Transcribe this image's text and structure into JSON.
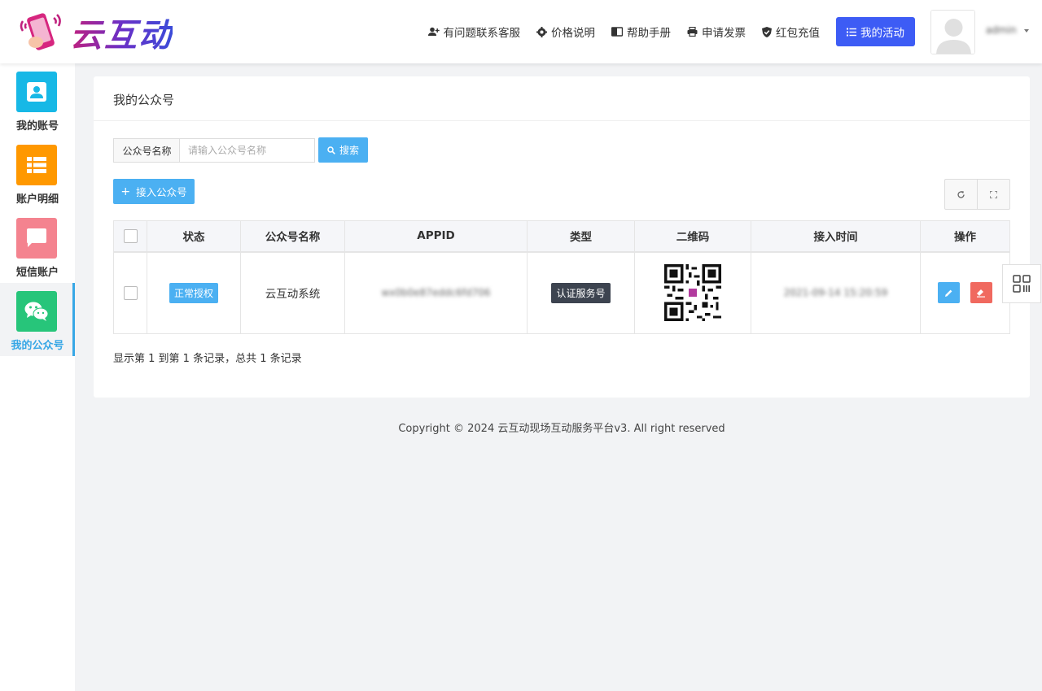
{
  "brand": {
    "name": "云互动"
  },
  "topnav": {
    "items": [
      {
        "label": "有问题联系客服",
        "icon": "user-plus-icon"
      },
      {
        "label": "价格说明",
        "icon": "gear-icon"
      },
      {
        "label": "帮助手册",
        "icon": "book-icon"
      },
      {
        "label": "申请发票",
        "icon": "printer-icon"
      },
      {
        "label": "红包充值",
        "icon": "shield-check-icon"
      }
    ],
    "activity_button": "我的活动",
    "user": {
      "name": "admin"
    }
  },
  "sidebar": {
    "items": [
      {
        "label": "我的账号",
        "color": "#17b8e6",
        "icon": "contact-card-icon"
      },
      {
        "label": "账户明细",
        "color": "#ff9800",
        "icon": "list-icon"
      },
      {
        "label": "短信账户",
        "color": "#f4838f",
        "icon": "chat-bubble-icon"
      },
      {
        "label": "我的公众号",
        "color": "#27c57a",
        "icon": "wechat-icon",
        "active": true
      }
    ]
  },
  "panel": {
    "title": "我的公众号",
    "search": {
      "label": "公众号名称",
      "placeholder": "请输入公众号名称",
      "button": "搜索"
    },
    "add_button": "接入公众号",
    "table": {
      "headers": [
        "状态",
        "公众号名称",
        "APPID",
        "类型",
        "二维码",
        "接入时间",
        "操作"
      ],
      "rows": [
        {
          "status": "正常授权",
          "name": "云互动系统",
          "appid": "wx0b0e87eddc6fd706",
          "type": "认证服务号",
          "time": "2021-09-14 15:20:59"
        }
      ]
    },
    "pager_info": "显示第 1 到第 1 条记录，总共 1 条记录"
  },
  "footer": {
    "copyright": "Copyright © 2024 云互动现场互动服务平台v3. All right reserved"
  },
  "colors": {
    "accent": "#4bb0f2",
    "primary": "#3d5cf5",
    "danger": "#f0695f"
  }
}
